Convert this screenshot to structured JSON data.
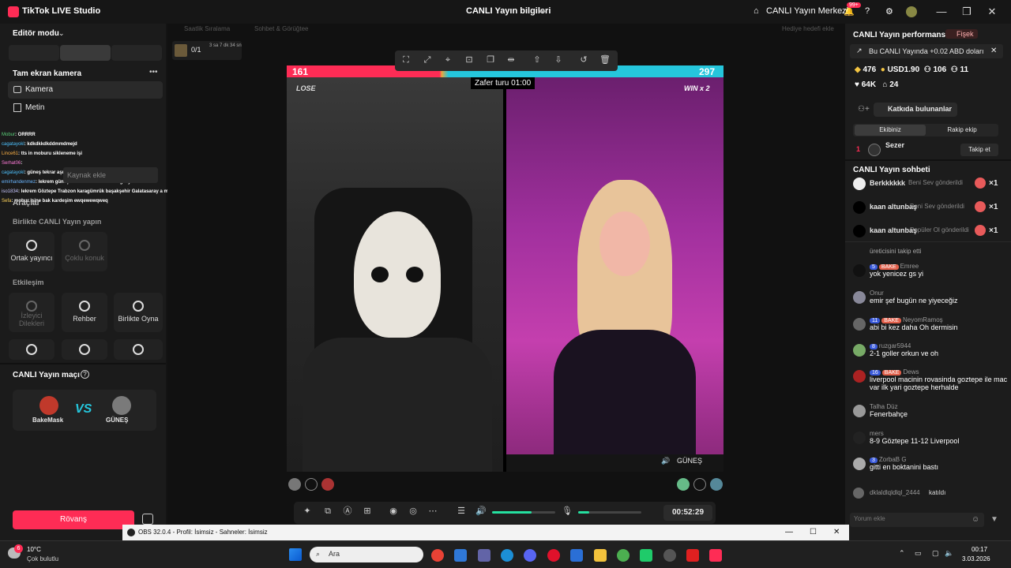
{
  "window": {
    "app_title": "TikTok LIVE Studio",
    "center_title": "CANLI Yayın bilgileri",
    "live_center": "CANLI Yayın Merkezi",
    "notif_count": "99+"
  },
  "left": {
    "editor_mode": "Editör modu",
    "camera_mode": "Tam ekran kamera",
    "sources": [
      "Kamera",
      "Metin"
    ],
    "tools_label": "Araçlar",
    "add_source_ghost": "Kaynak ekle",
    "together_section": "Birlikte CANLI Yayın yapın",
    "together_tiles": [
      "Ortak yayıncı",
      "Çoklu konuk"
    ],
    "interaction_section": "Etkileşim",
    "interaction_tiles": [
      "İzleyici Dilekleri",
      "Rehber",
      "Birlikte Oyna"
    ],
    "match_section": "CANLI Yayın maçı",
    "player1": "BakeMask",
    "player2": "GÜNEŞ",
    "vs": "VS",
    "rematch": "Rövanş"
  },
  "chat_overlay": [
    {
      "name": "Mobur",
      "text": ": ORRRR"
    },
    {
      "name": "cagatayokl",
      "text": ": kdkdkkdkddmmdmejd"
    },
    {
      "name": "Lince61",
      "text": ": tts in moburu sikleneme işi"
    },
    {
      "name": "Serhat06",
      "text": ":"
    },
    {
      "name": "cagatayokl",
      "text": ": güneş tekrar aşık olacam mı"
    },
    {
      "name": "emirhandenmez",
      "text": ": lekrem güneş hanım sözde mersine geliyordu"
    },
    {
      "name": "iso1834",
      "text": ": lekrem Göztepe Trabzon karagümrük başakşehir Galatasaray a maçları veriyor"
    },
    {
      "name": "Sefa",
      "text": ": mobur işine bak kardeşim ewqewewqweq"
    }
  ],
  "stage": {
    "top_tabs": [
      "Saatlik Sıralama",
      "Sohbet & Görüğtee",
      "Hediye hedefi ekle"
    ],
    "goal": "0/1",
    "goal_time": "3 sa 7 dk 34 sn",
    "score_left": "161",
    "score_right": "297",
    "round_label": "Zafer turu 01:00",
    "lose_label": "LOSE",
    "win_label": "WIN x 2",
    "right_name": "GÜNEŞ",
    "timer": "00:52:29",
    "volume_level": 0.62,
    "mic_level": 0.18
  },
  "right": {
    "performance": "CANLI Yayın performansı",
    "fisek": "Fişek",
    "earn_note": "Bu CANLI Yayında +0.02 ABD doları",
    "stats": [
      "476",
      "USD1.90",
      "106",
      "11",
      "64K",
      "24"
    ],
    "contributors": "Katkıda bulunanlar",
    "tab_team": "Ekibiniz",
    "tab_rival": "Rakip ekip",
    "top_rank": "1",
    "top_user": "Sezer",
    "follow": "Takip et",
    "chat_title": "CANLI Yayın sohbeti",
    "gifts": [
      {
        "user": "Berkkkkkk",
        "text": "Beni Sev gönderildi",
        "count": "×1"
      },
      {
        "user": "kaan altunbaş",
        "text": "Beni Sev gönderildi",
        "count": "×1"
      },
      {
        "user": "kaan altunbaş",
        "text": "Popüler Ol gönderildi",
        "count": "×1"
      }
    ],
    "cut_line": "üreticisini takip etti",
    "messages": [
      {
        "level": "5",
        "tag": "BAKE",
        "name": "Emree",
        "text": "yok yenicez gs yi"
      },
      {
        "level": "",
        "tag": "",
        "name": "Onur",
        "text": "emir şef bugün ne yiyeceğiz"
      },
      {
        "level": "11",
        "tag": "BAKE",
        "name": "NeyomRamoş",
        "text": "abi bi kez daha Oh dermisin"
      },
      {
        "level": "8",
        "tag": "",
        "name": "ruzgar5944",
        "text": "2-1 goller orkun ve oh"
      },
      {
        "level": "16",
        "tag": "BAKE",
        "name": "Dews",
        "text": "liverpool macinin rovasinda goztepe ile mac var ilk yari goztepe herhalde"
      },
      {
        "level": "",
        "tag": "",
        "name": "Talha Düz",
        "text": "Fenerbahçe"
      },
      {
        "level": "",
        "tag": "",
        "name": "mers",
        "text": "8-9 Göztepe 11-12 Liverpool"
      },
      {
        "level": "3",
        "tag": "",
        "name": "ZorbaB G",
        "text": "gitti en boktanini bastı"
      }
    ],
    "joined_user": "dklaldlqldlql_2444",
    "joined_text": "katıldı",
    "comment_placeholder": "Yorum ekle"
  },
  "obs": {
    "title": "OBS 32.0.4 - Profil: İsimsiz - Sahneler: İsimsiz"
  },
  "taskbar": {
    "weather_temp": "10°C",
    "weather_desc": "Çok bulutlu",
    "search": "Ara",
    "time": "00:17",
    "date": "3.03.2026",
    "weather_badge": "6"
  },
  "colors": {
    "accent": "#fe2c55",
    "teal": "#25c6dc"
  }
}
